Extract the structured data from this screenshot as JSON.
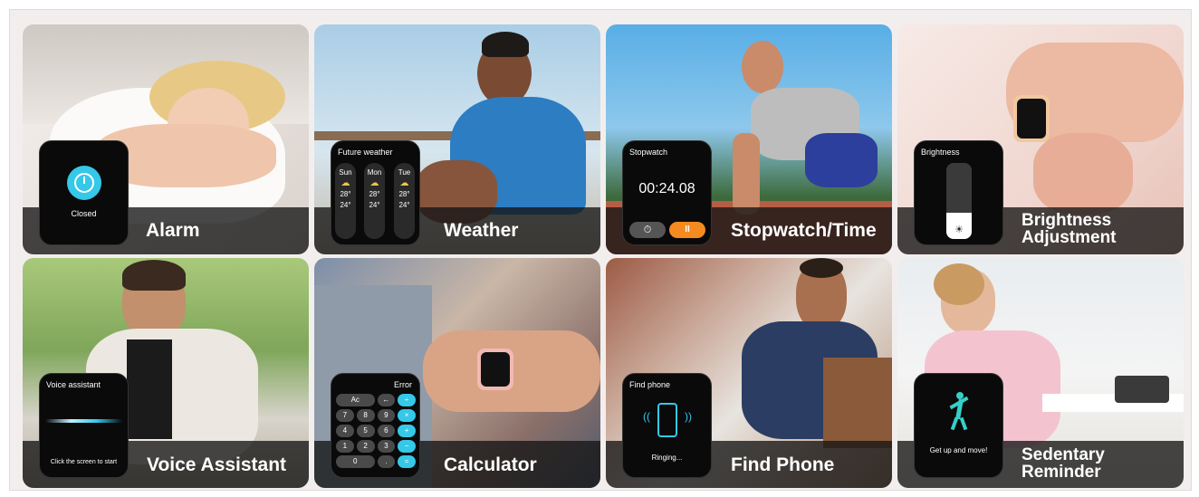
{
  "colors": {
    "accent_blue": "#35c8e8",
    "accent_orange": "#f58a1f",
    "caption_bar": "#1e1e1e"
  },
  "tiles": [
    {
      "caption": "Alarm",
      "watch": {
        "label": "Closed",
        "icon": "alarm-clock-icon"
      }
    },
    {
      "caption": "Weather",
      "watch": {
        "title": "Future weather",
        "days": [
          {
            "day": "Sun",
            "high": "28°",
            "low": "24°"
          },
          {
            "day": "Mon",
            "high": "28°",
            "low": "24°"
          },
          {
            "day": "Tue",
            "high": "28°",
            "low": "24°"
          }
        ],
        "icon": "partly-cloudy-icon"
      }
    },
    {
      "caption": "Stopwatch/Time",
      "watch": {
        "title": "Stopwatch",
        "time": "00:24.08",
        "icons": [
          "timer-icon",
          "pause-icon"
        ]
      }
    },
    {
      "caption_line1": "Brightness",
      "caption_line2": "Adjustment",
      "watch": {
        "title": "Brightness",
        "level": 0.35,
        "icon": "sun-icon"
      }
    },
    {
      "caption": "Voice Assistant",
      "watch": {
        "title": "Voice assistant",
        "hint": "Click the screen to start",
        "icon": "voice-wave-icon"
      }
    },
    {
      "caption": "Calculator",
      "watch": {
        "display": "Error",
        "keys": [
          "Ac",
          "←",
          "÷",
          "7",
          "8",
          "9",
          "×",
          "4",
          "5",
          "6",
          "+",
          "1",
          "2",
          "3",
          "−",
          "0",
          ".",
          "="
        ]
      }
    },
    {
      "caption": "Find Phone",
      "watch": {
        "title": "Find phone",
        "status": "Ringing...",
        "icon": "phone-ringing-icon"
      }
    },
    {
      "caption_line1": "Sedentary",
      "caption_line2": "Reminder",
      "watch": {
        "message": "Get up and move!",
        "icon": "stretching-person-icon"
      }
    }
  ]
}
